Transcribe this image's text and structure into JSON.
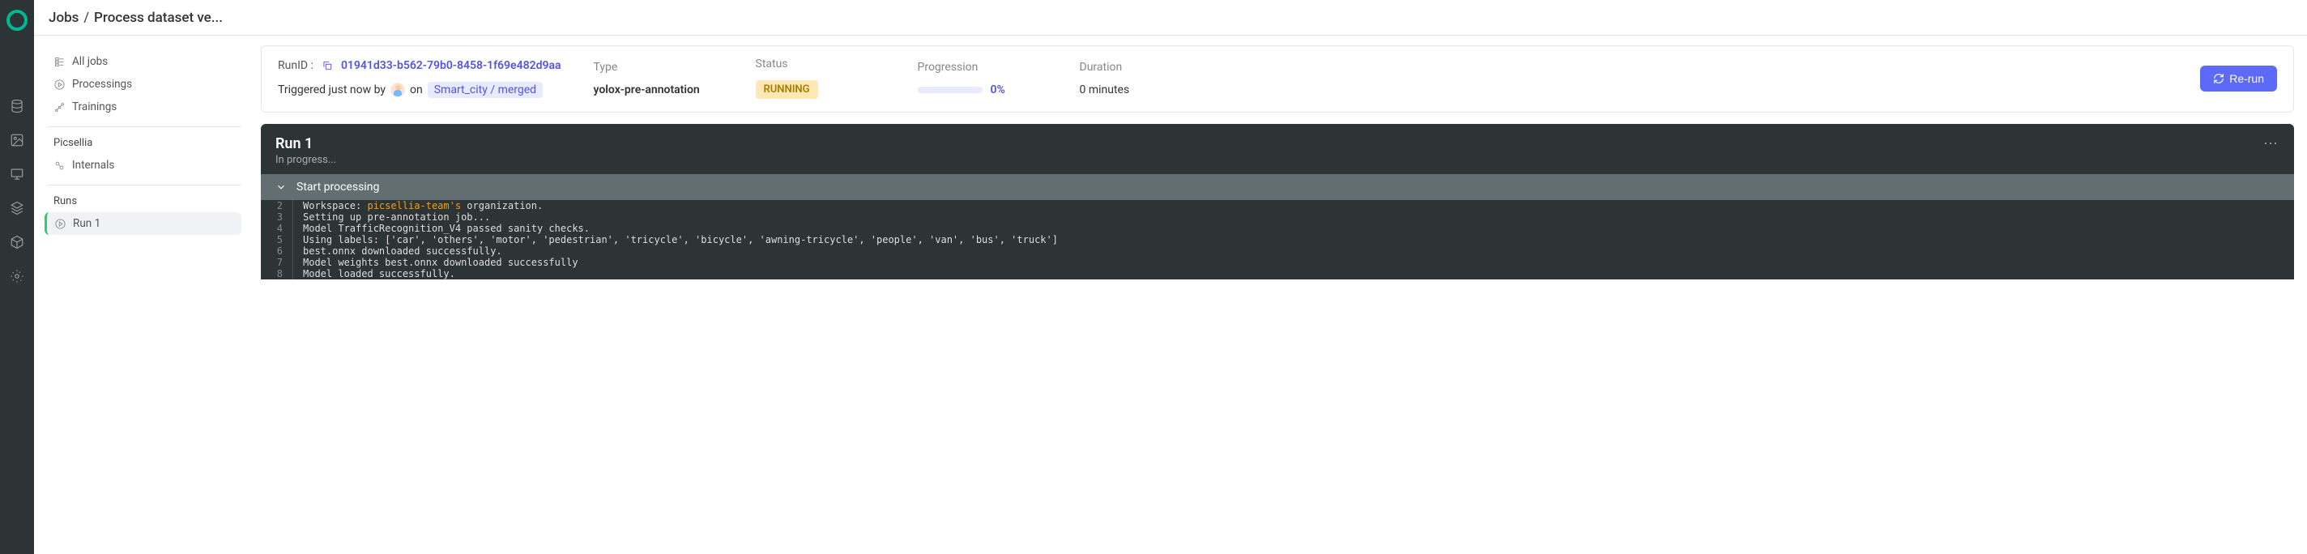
{
  "breadcrumb": {
    "root": "Jobs",
    "current": "Process dataset ve..."
  },
  "sidebar": {
    "items": [
      {
        "label": "All jobs"
      },
      {
        "label": "Processings"
      },
      {
        "label": "Trainings"
      }
    ],
    "heading1": "Picsellia",
    "internals": "Internals",
    "heading2": "Runs",
    "run": "Run 1"
  },
  "info": {
    "runid_label": "RunID :",
    "runid": "01941d33-b562-79b0-8458-1f69e482d9aa",
    "trigger_prefix": "Triggered just now by",
    "trigger_on": "on",
    "project_chip": "Smart_city / merged",
    "type_label": "Type",
    "type_value": "yolox-pre-annotation",
    "status_label": "Status",
    "status_value": "RUNNING",
    "progress_label": "Progression",
    "progress_pct": "0%",
    "duration_label": "Duration",
    "duration_value": "0 minutes",
    "rerun": "Re-run"
  },
  "run": {
    "title": "Run 1",
    "subtitle": "In progress...",
    "section": "Start processing",
    "log_lines": {
      "l2a": "Workspace: ",
      "l2b": "picsellia-team's",
      "l2c": " organization.",
      "l3": "Setting up pre-annotation job...",
      "l4": "Model TrafficRecognition_V4 passed sanity checks.",
      "l5": "Using labels: ['car', 'others', 'motor', 'pedestrian', 'tricycle', 'bicycle', 'awning-tricycle', 'people', 'van', 'bus', 'truck']",
      "l6": "best.onnx downloaded successfully.",
      "l7": "Model weights best.onnx downloaded successfully",
      "l8": "Model loaded successfully."
    },
    "gutters": {
      "g2": "2",
      "g3": "3",
      "g4": "4",
      "g5": "5",
      "g6": "6",
      "g7": "7",
      "g8": "8"
    }
  }
}
